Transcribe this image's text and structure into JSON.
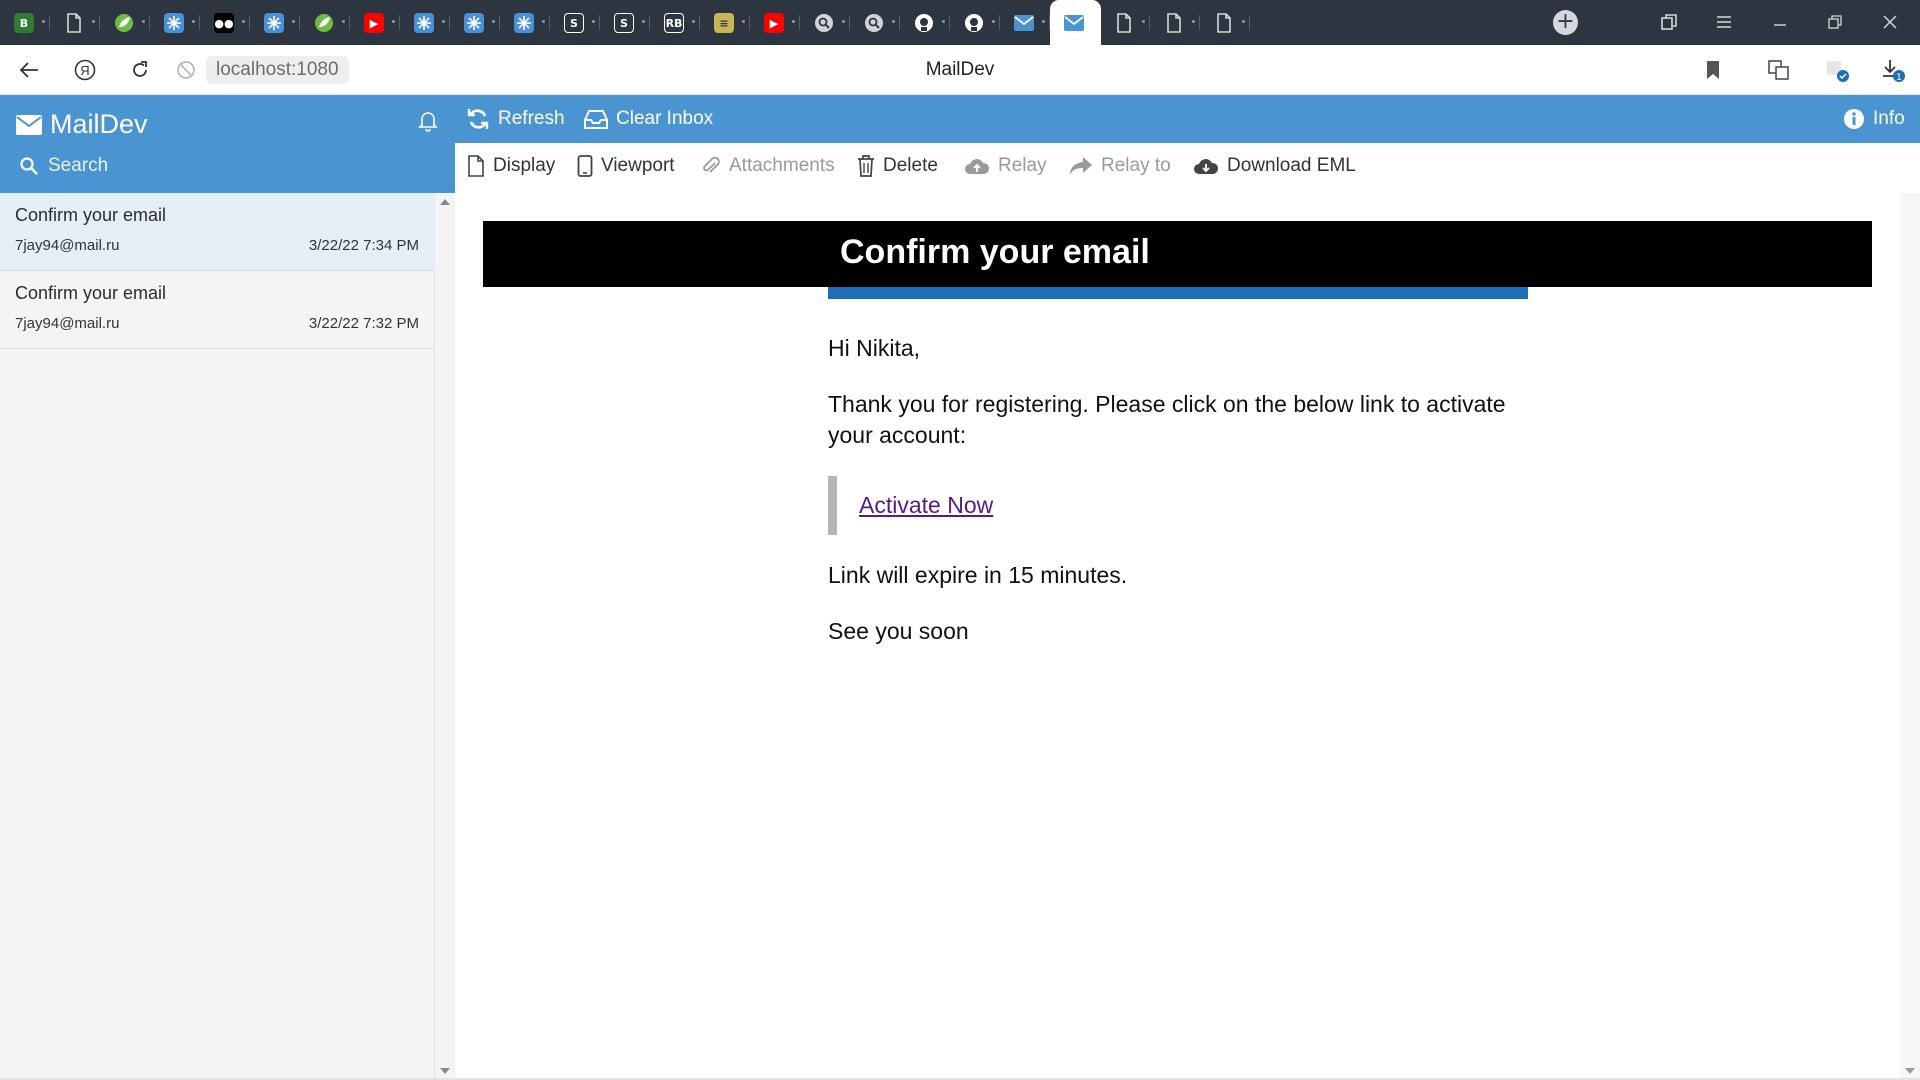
{
  "browser": {
    "tabs": [
      {
        "icon": "b-icon",
        "color": "#2e7d32",
        "glyph": "B"
      },
      {
        "icon": "page-icon",
        "color": "",
        "glyph": ""
      },
      {
        "icon": "leaf-icon",
        "color": "#6dbd45",
        "glyph": ""
      },
      {
        "icon": "sparkle-icon",
        "color": "#4a90d9",
        "glyph": ""
      },
      {
        "icon": "medium-icon",
        "color": "#000000",
        "glyph": "●●"
      },
      {
        "icon": "sparkle-icon",
        "color": "#4a90d9",
        "glyph": ""
      },
      {
        "icon": "leaf-icon",
        "color": "#6dbd45",
        "glyph": ""
      },
      {
        "icon": "youtube-icon",
        "color": "#ff0000",
        "glyph": "▶"
      },
      {
        "icon": "sparkle-icon",
        "color": "#4a90d9",
        "glyph": ""
      },
      {
        "icon": "sparkle-icon",
        "color": "#4a90d9",
        "glyph": ""
      },
      {
        "icon": "sparkle-icon",
        "color": "#4a90d9",
        "glyph": ""
      },
      {
        "icon": "link-icon",
        "color": "#ffffff",
        "glyph": "S"
      },
      {
        "icon": "link-icon",
        "color": "#ffffff",
        "glyph": "S"
      },
      {
        "icon": "rb-icon",
        "color": "#ffffff",
        "glyph": "RB"
      },
      {
        "icon": "document-icon",
        "color": "#c9b458",
        "glyph": "≡"
      },
      {
        "icon": "youtube-icon",
        "color": "#ff0000",
        "glyph": "▶"
      },
      {
        "icon": "search-page-icon",
        "color": "#d0d4d8",
        "glyph": ""
      },
      {
        "icon": "search-page-icon",
        "color": "#d0d4d8",
        "glyph": ""
      },
      {
        "icon": "github-icon",
        "color": "#ffffff",
        "glyph": ""
      },
      {
        "icon": "github-icon",
        "color": "#ffffff",
        "glyph": ""
      },
      {
        "icon": "mail-icon",
        "color": "#4a94d1",
        "glyph": ""
      },
      {
        "icon": "mail-icon",
        "color": "#4a94d1",
        "glyph": "",
        "active": true
      },
      {
        "icon": "page-icon",
        "color": "",
        "glyph": ""
      },
      {
        "icon": "page-icon",
        "color": "",
        "glyph": ""
      },
      {
        "icon": "page-icon",
        "color": "",
        "glyph": ""
      }
    ],
    "url": "localhost:1080",
    "page_title": "MailDev"
  },
  "app": {
    "brand": "MailDev",
    "search_placeholder": "Search",
    "refresh_label": "Refresh",
    "clear_inbox_label": "Clear Inbox",
    "info_label": "Info",
    "accent": "#4a94d1"
  },
  "toolbar": {
    "display": "Display",
    "viewport": "Viewport",
    "attachments": "Attachments",
    "delete": "Delete",
    "relay": "Relay",
    "relay_to": "Relay to",
    "download_eml": "Download EML"
  },
  "messages": [
    {
      "subject": "Confirm your email",
      "from": "7jay94@mail.ru",
      "date": "3/22/22 7:34 PM",
      "selected": true
    },
    {
      "subject": "Confirm your email",
      "from": "7jay94@mail.ru",
      "date": "3/22/22 7:32 PM",
      "selected": false
    }
  ],
  "email": {
    "heading": "Confirm your email",
    "greeting": "Hi Nikita,",
    "intro": "Thank you for registering. Please click on the below link to activate your account:",
    "link_text": "Activate Now",
    "expiry": "Link will expire in 15 minutes.",
    "signoff": "See you soon"
  }
}
